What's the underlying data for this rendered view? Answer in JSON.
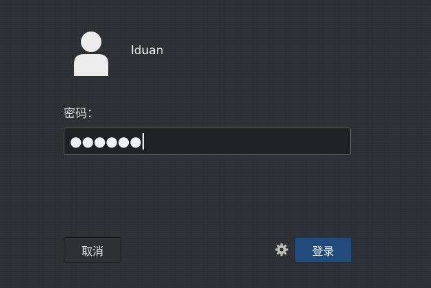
{
  "user": {
    "avatar_icon": "user-avatar-icon",
    "name": "lduan"
  },
  "password": {
    "label": "密码：",
    "masked_value": "●●●●●●"
  },
  "buttons": {
    "cancel_label": "取消",
    "login_label": "登录",
    "settings_icon": "gear-icon"
  },
  "colors": {
    "background": "#2c2f33",
    "login_button": "#214b7a"
  }
}
